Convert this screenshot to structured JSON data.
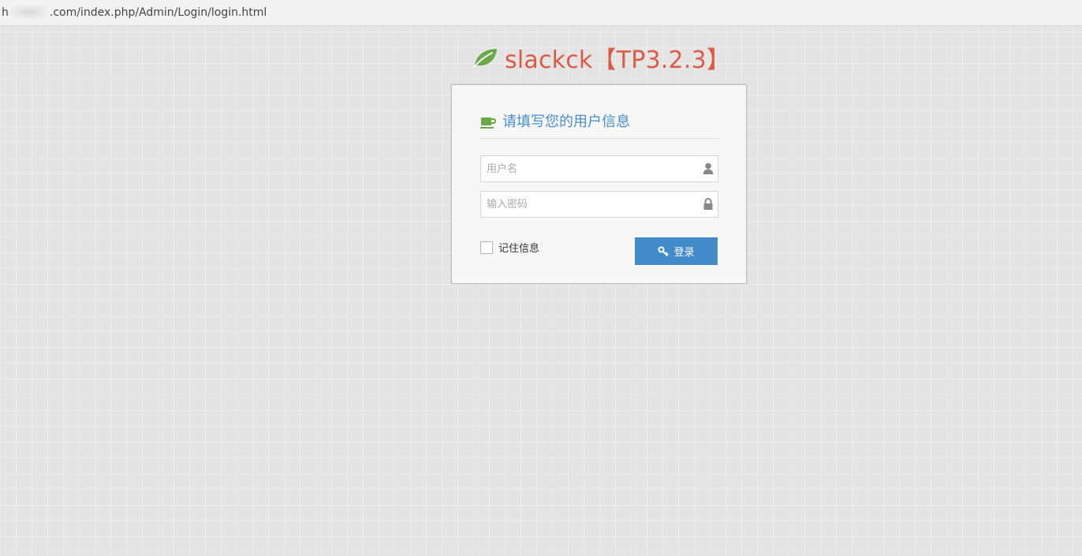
{
  "browser": {
    "url_prefix": "h",
    "url_suffix": ".com/index.php/Admin/Login/login.html"
  },
  "brand": {
    "text": "slackck【TP3.2.3】",
    "leaf_icon": "leaf-icon",
    "color": "#dd5a43",
    "leaf_color": "#69aa46"
  },
  "login": {
    "header_title": "请填写您的用户信息",
    "header_icon": "coffee-icon",
    "username": {
      "value": "",
      "placeholder": "用户名",
      "icon": "user-icon"
    },
    "password": {
      "value": "",
      "placeholder": "输入密码",
      "icon": "lock-icon"
    },
    "remember_label": "记住信息",
    "remember_checked": false,
    "submit_label": "登录",
    "submit_icon": "key-icon",
    "accent_color": "#428bca",
    "title_color": "#478fca"
  }
}
